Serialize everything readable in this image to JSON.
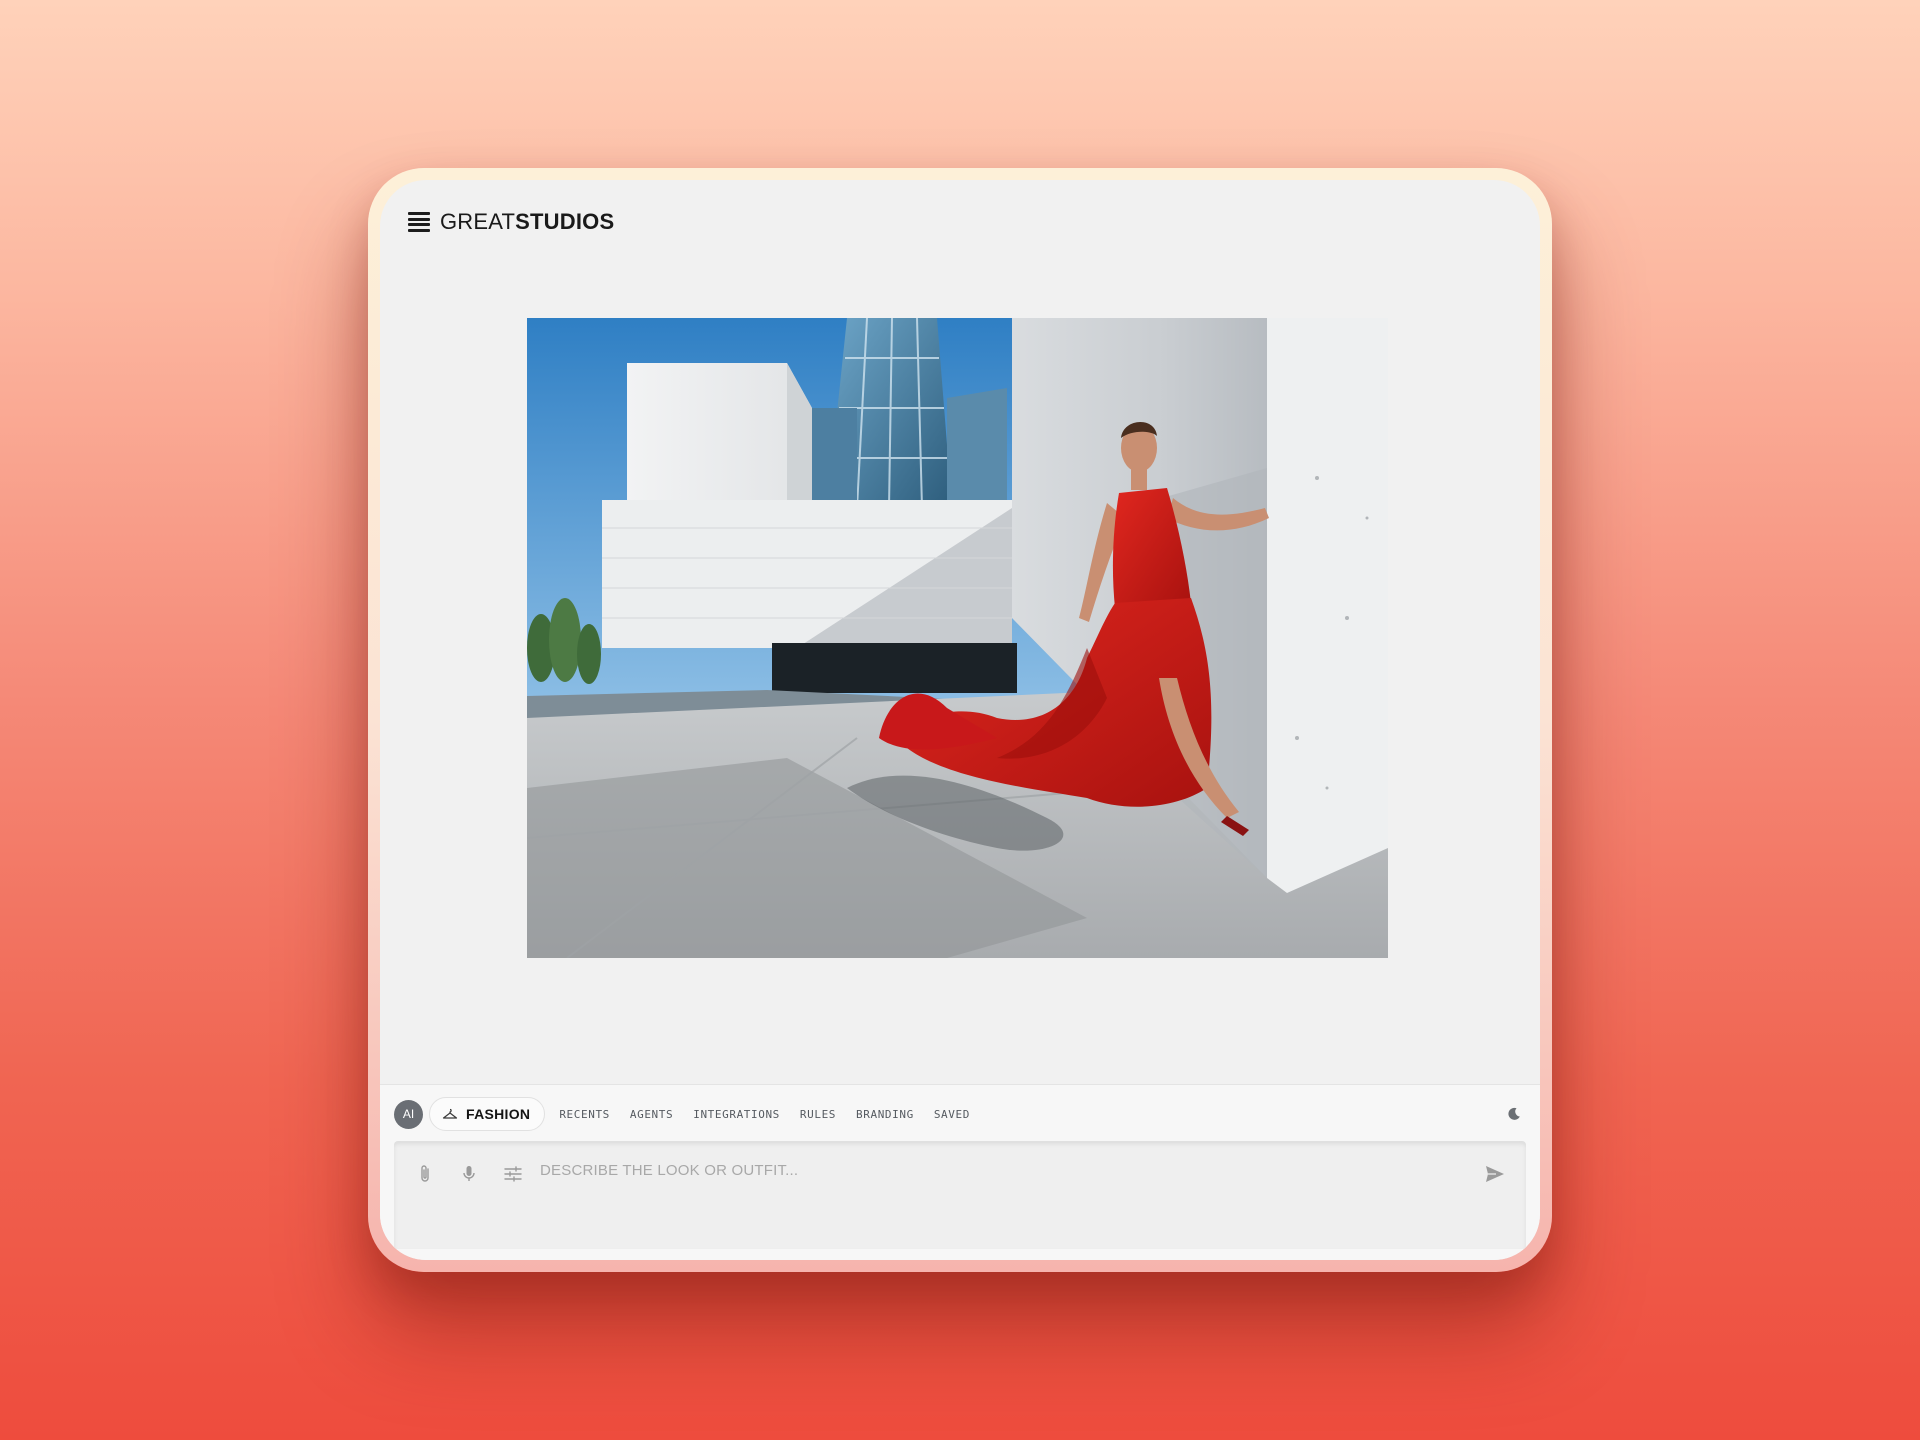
{
  "app": {
    "logo_light": "GREAT",
    "logo_bold": "STUDIOS"
  },
  "header": {
    "menu_icon": "hamburger-menu-icon"
  },
  "canvas": {
    "image_subject": "fashion-photo-red-gown"
  },
  "toolbar": {
    "ai_label": "AI",
    "mode_chip_icon": "hanger-icon",
    "mode_chip_label": "FASHION",
    "nav_items": [
      "RECENTS",
      "AGENTS",
      "INTEGRATIONS",
      "RULES",
      "BRANDING",
      "SAVED"
    ],
    "theme_icon": "moon-icon"
  },
  "composer": {
    "placeholder": "DESCRIBE THE LOOK OR OUTFIT...",
    "value": "",
    "tools": [
      "paperclip-icon",
      "microphone-icon",
      "sliders-icon"
    ],
    "send_icon": "send-icon"
  },
  "colors": {
    "accent_dress": "#d2201c",
    "panel_bg": "#f1f1f1",
    "ai_badge": "#6a6e74"
  }
}
